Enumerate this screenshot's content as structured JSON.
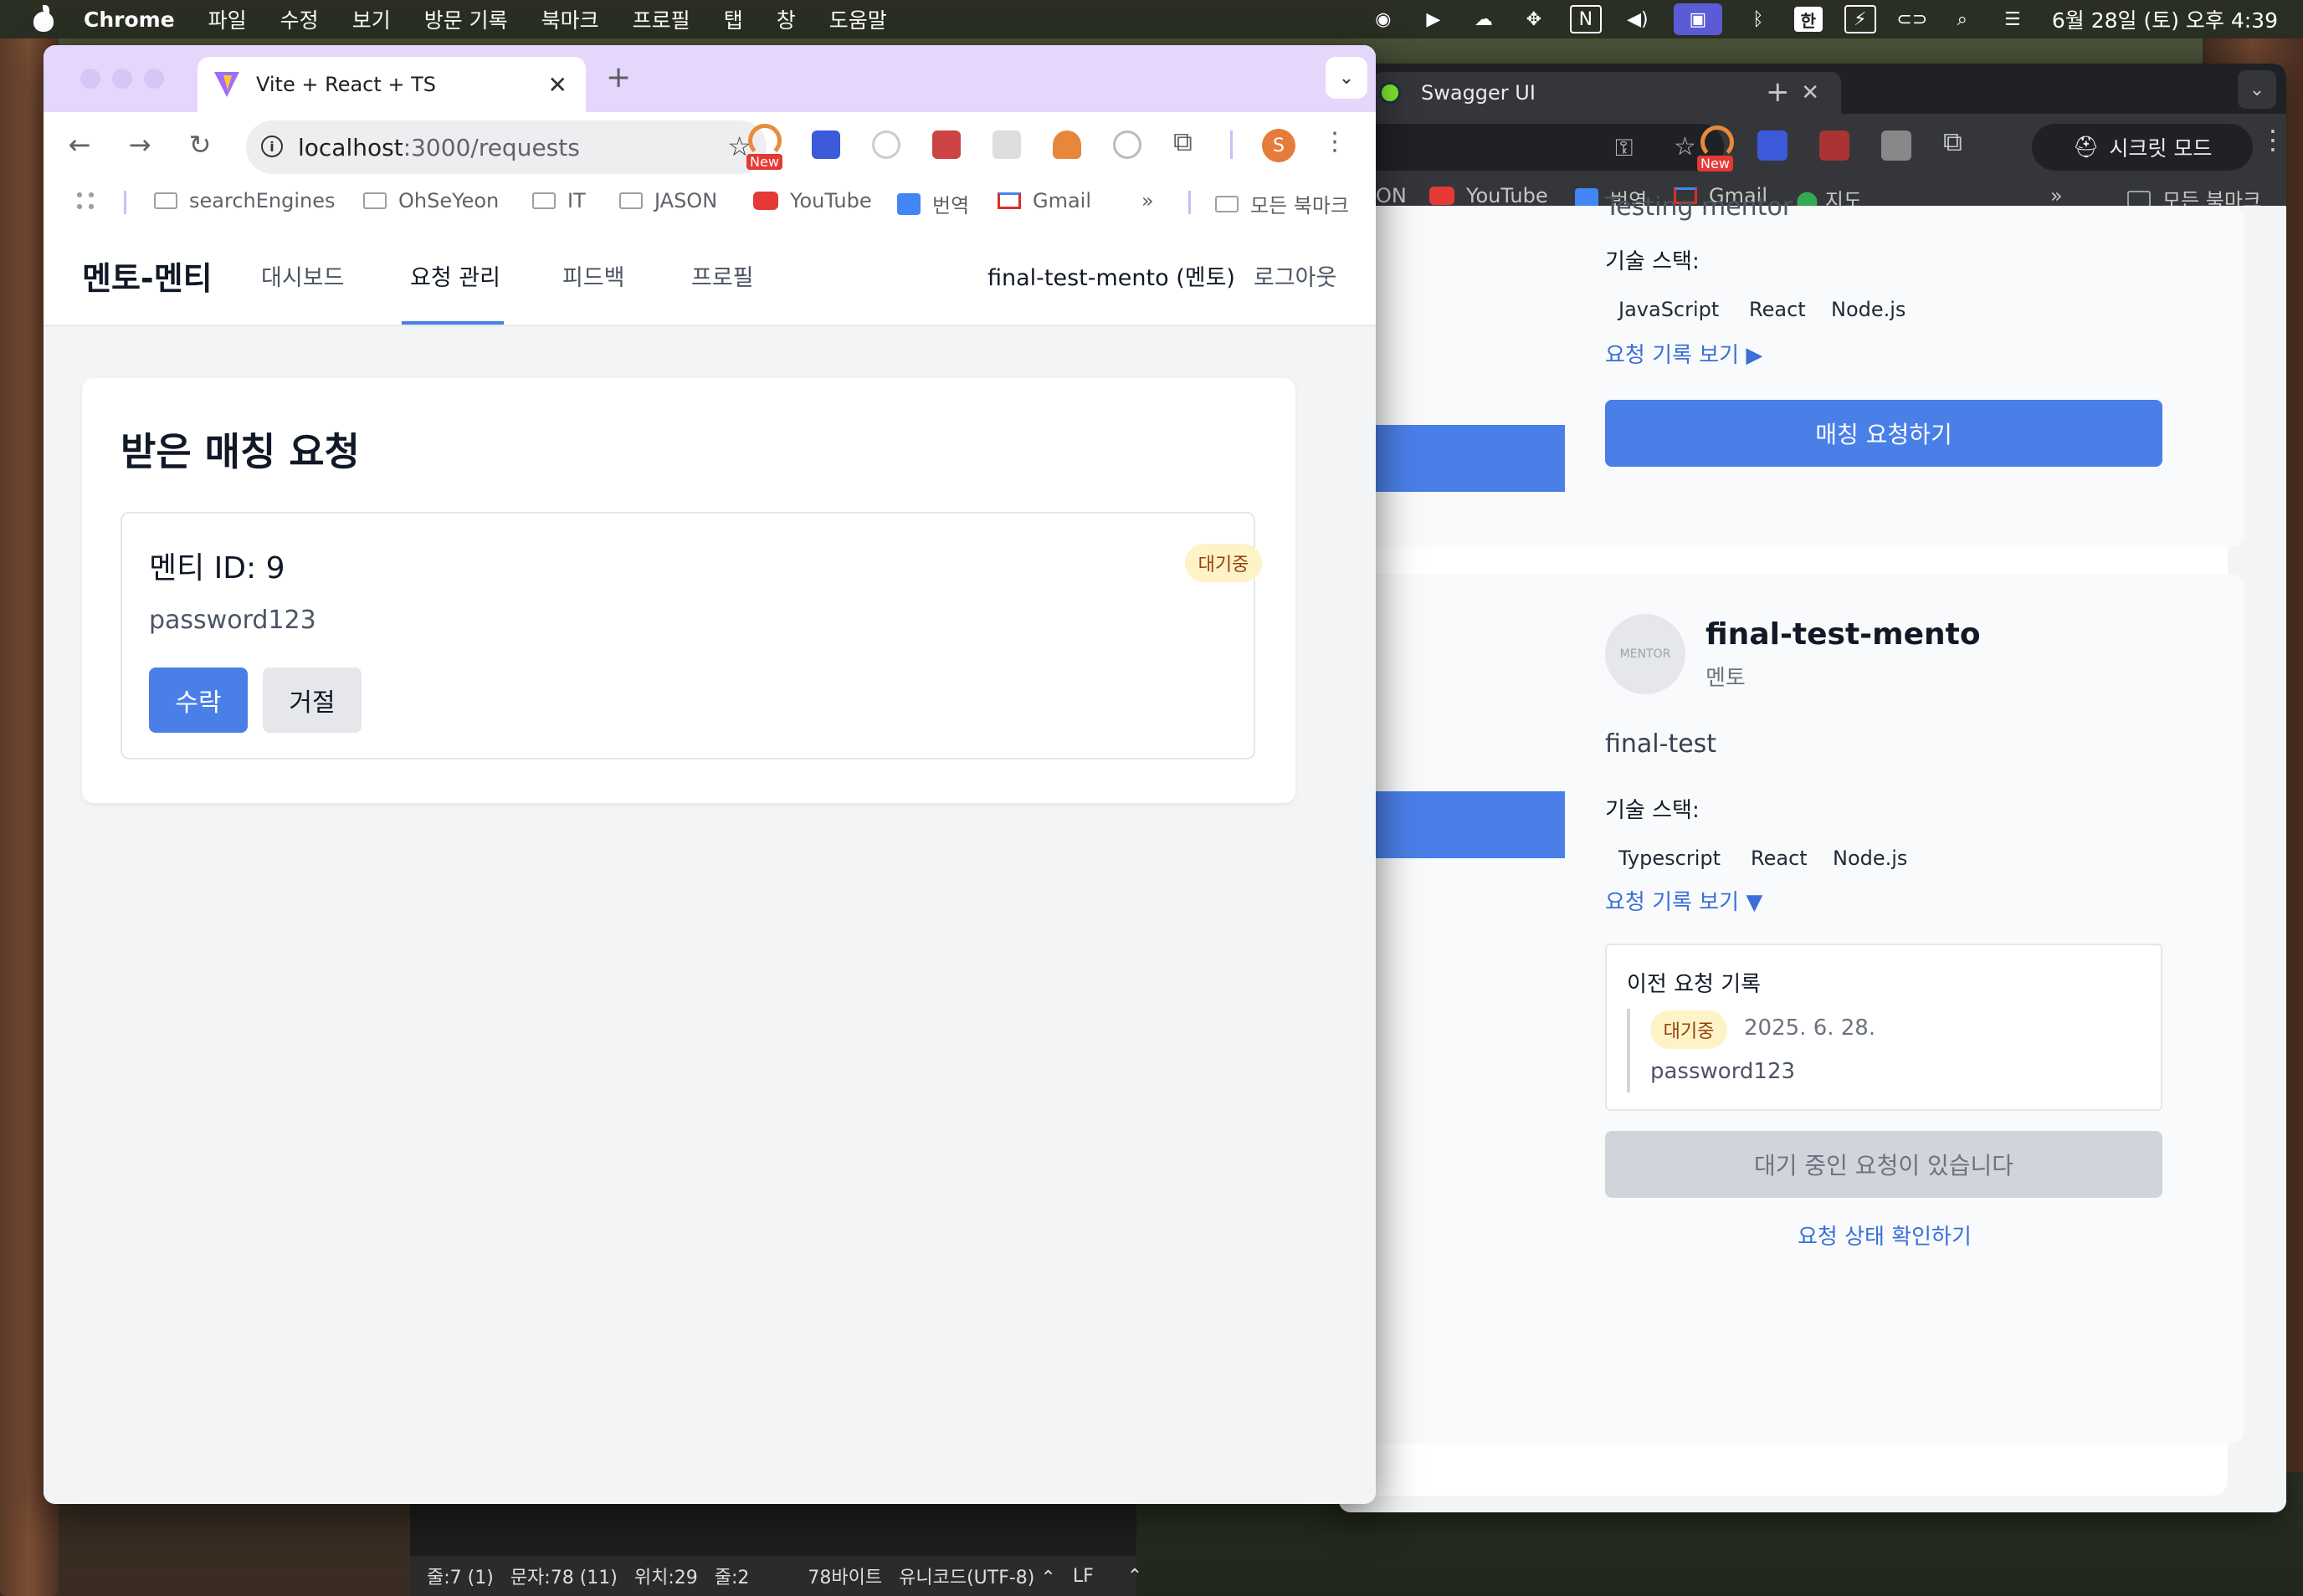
{
  "menubar": {
    "app_name": "Chrome",
    "items": [
      "파일",
      "수정",
      "보기",
      "방문 기록",
      "북마크",
      "프로필",
      "탭",
      "창",
      "도움말"
    ],
    "ime": "한",
    "clock": "6월 28일 (토) 오후 4:39"
  },
  "front_window": {
    "tab_title": "Vite + React + TS",
    "url_host": "localhost",
    "url_path": ":3000/requests",
    "profile_initial": "S",
    "new_badge": "New",
    "bookmarks": [
      "searchEngines",
      "OhSeYeon",
      "IT",
      "JASON",
      "YouTube",
      "번역",
      "Gmail"
    ],
    "bookmarks_overflow": "»",
    "all_bookmarks": "모든 북마크",
    "app": {
      "brand": "멘토-멘티",
      "nav": [
        "대시보드",
        "요청 관리",
        "피드백",
        "프로필"
      ],
      "active_nav": "요청 관리",
      "user": "final-test-mento (멘토)",
      "logout": "로그아웃",
      "heading": "받은 매칭 요청",
      "request": {
        "title": "멘티 ID: 9",
        "status": "대기중",
        "message": "password123",
        "accept_label": "수락",
        "reject_label": "거절"
      }
    }
  },
  "back_window": {
    "tab_title": "Swagger UI",
    "new_badge": "New",
    "incognito_label": "시크릿 모드",
    "bookmarks": [
      "ON",
      "YouTube",
      "번역",
      "Gmail",
      "지도"
    ],
    "bookmarks_overflow": "»",
    "all_bookmarks": "모든 북마크",
    "mentor_card_1": {
      "bio_partial": "Testing mentor",
      "skills_label": "기술 스택:",
      "skills": [
        "JavaScript",
        "React",
        "Node.js"
      ],
      "history_toggle": "요청 기록 보기 ▶",
      "request_button": "매칭 요청하기"
    },
    "mentor_card_2": {
      "avatar_text": "MENTOR",
      "name": "final-test-mento",
      "role": "멘토",
      "bio": "final-test",
      "skills_label": "기술 스택:",
      "skills": [
        "Typescript",
        "React",
        "Node.js"
      ],
      "history_toggle": "요청 기록 보기 ▼",
      "history_title": "이전 요청 기록",
      "history_status": "대기중",
      "history_date": "2025. 6. 28.",
      "history_message": "password123",
      "pending_button": "대기 중인 요청이 있습니다",
      "check_status_link": "요청 상태 확인하기"
    }
  },
  "editor_status": {
    "line": "줄:7 (1)",
    "chars": "문자:78 (11)",
    "pos": "위치:29",
    "col": "줄:2",
    "bytes": "78바이트",
    "encoding": "유니코드(UTF-8) ⌃",
    "eol": "LF",
    "arrow": "⌃"
  }
}
